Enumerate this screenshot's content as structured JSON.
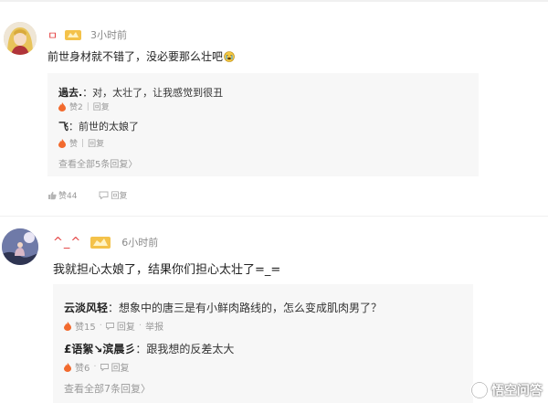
{
  "comment1": {
    "username": "ㅁ",
    "time": "3小时前",
    "content": "前世身材就不错了，没必要那么壮吧",
    "replies": [
      {
        "name": "過去.",
        "text": "：对，太壮了，让我感觉到很丑",
        "likes": "赞2",
        "reply": "回复"
      },
      {
        "name": "飞",
        "text": "：前世的太娘了",
        "likes": "赞",
        "reply": "回复"
      }
    ],
    "view_all": "查看全部5条回复〉",
    "footer": {
      "likes": "赞44",
      "reply": "回复"
    }
  },
  "comment2": {
    "username": "^_^",
    "time": "6小时前",
    "content": "我就担心太娘了，结果你们担心太壮了=_=",
    "replies": [
      {
        "name": "云淡风轻",
        "text": "：想象中的唐三是有小鲜肉路线的，怎么变成肌肉男了？",
        "likes": "赞15",
        "reply": "回复",
        "report": "举报"
      },
      {
        "name": "£语絮↘滨晨彡",
        "text": "：跟我想的反差太大",
        "likes": "赞6",
        "reply": "回复"
      }
    ],
    "view_all": "查看全部7条回复〉"
  },
  "watermark": {
    "text": "悟空问答"
  },
  "colors": {
    "username": "#e33e3e",
    "reply_bg": "#f7f7f7",
    "fire": "#f26a2e",
    "meta": "#8a8a8a"
  }
}
